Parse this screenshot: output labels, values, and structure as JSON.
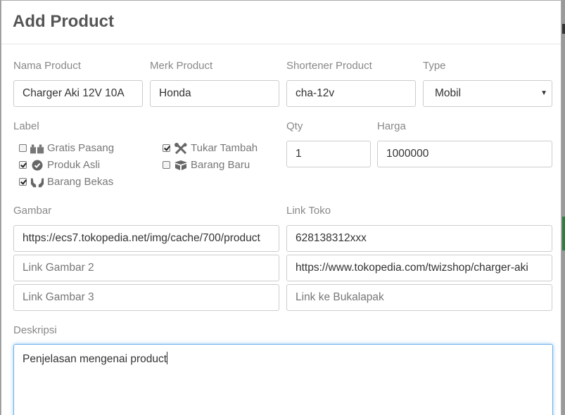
{
  "modal": {
    "title": "Add Product"
  },
  "fields": {
    "nama_product": {
      "label": "Nama Product",
      "value": "Charger Aki 12V 10A"
    },
    "merk_product": {
      "label": "Merk Product",
      "value": "Honda"
    },
    "shortener_product": {
      "label": "Shortener Product",
      "value": "cha-12v"
    },
    "type": {
      "label": "Type",
      "value": "Mobil"
    },
    "qty": {
      "label": "Qty",
      "value": "1"
    },
    "harga": {
      "label": "Harga",
      "value": "1000000"
    },
    "gambar": {
      "label": "Gambar",
      "link1_value": "https://ecs7.tokopedia.net/img/cache/700/product",
      "link2_placeholder": "Link Gambar 2",
      "link3_placeholder": "Link Gambar 3"
    },
    "link_toko": {
      "label": "Link Toko",
      "phone_value": "628138312xxx",
      "tokopedia_value": "https://www.tokopedia.com/twizshop/charger-aki",
      "bukalapak_placeholder": "Link ke Bukalapak"
    },
    "deskripsi": {
      "label": "Deskripsi",
      "value": "Penjelasan mengenai product"
    }
  },
  "label_section": {
    "title": "Label",
    "options": [
      {
        "text": "Gratis Pasang",
        "checked": false,
        "icon": "gift-icon"
      },
      {
        "text": "Tukar Tambah",
        "checked": true,
        "icon": "tools-icon"
      },
      {
        "text": "Produk Asli",
        "checked": true,
        "icon": "check-circle-icon"
      },
      {
        "text": "Barang Baru",
        "checked": false,
        "icon": "box-icon"
      },
      {
        "text": "Barang Bekas",
        "checked": true,
        "icon": "hands-icon"
      }
    ]
  },
  "colors": {
    "focus_border": "#66afe9",
    "label_text": "#888888",
    "title_text": "#555555"
  }
}
